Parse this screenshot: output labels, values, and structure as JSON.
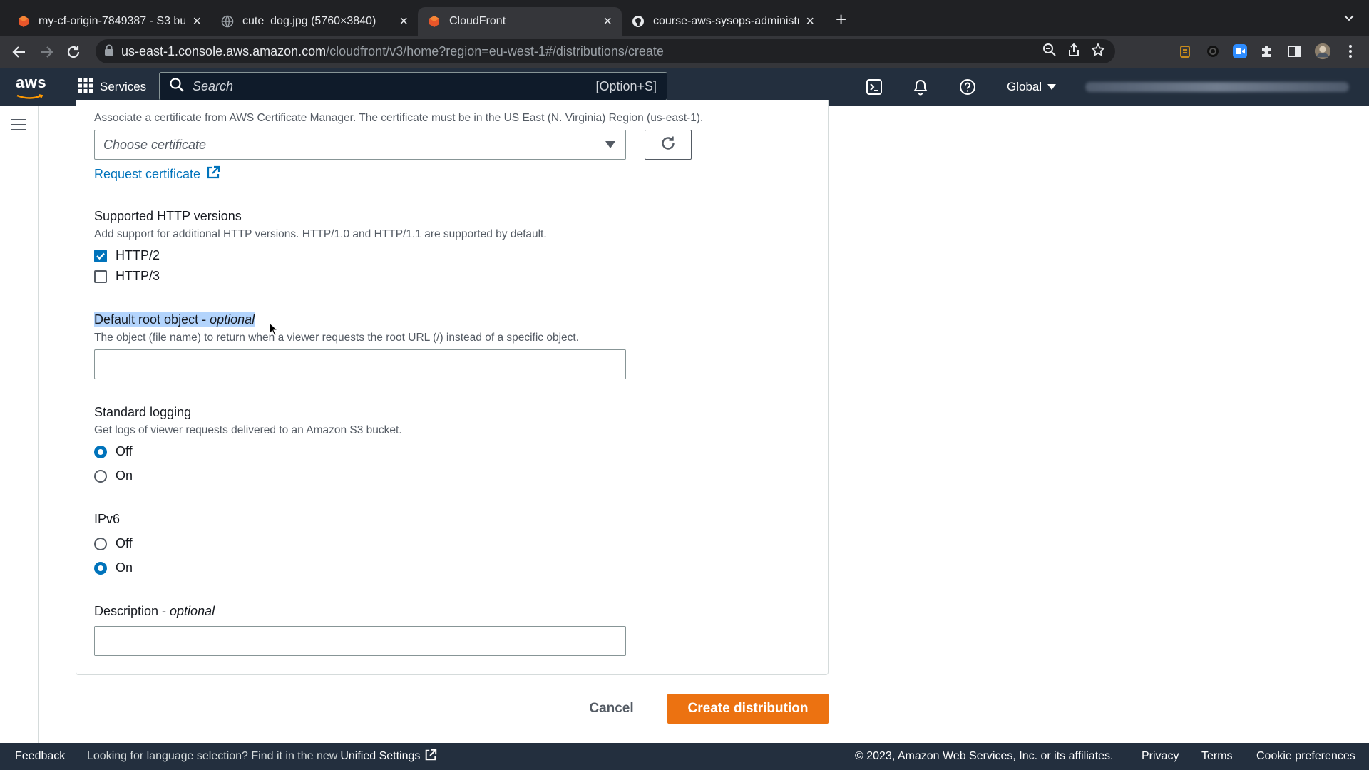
{
  "browser": {
    "tabs": [
      {
        "title": "my-cf-origin-7849387 - S3 bu"
      },
      {
        "title": "cute_dog.jpg (5760×3840)"
      },
      {
        "title": "CloudFront"
      },
      {
        "title": "course-aws-sysops-administra"
      }
    ],
    "url_host": "us-east-1.console.aws.amazon.com",
    "url_path": "/cloudfront/v3/home?region=eu-west-1#/distributions/create"
  },
  "awsnav": {
    "logo_text": "aws",
    "services_label": "Services",
    "search_placeholder": "Search",
    "search_shortcut": "[Option+S]",
    "region_label": "Global"
  },
  "form": {
    "certificate": {
      "description": "Associate a certificate from AWS Certificate Manager. The certificate must be in the US East (N. Virginia) Region (us-east-1).",
      "placeholder": "Choose certificate",
      "request_link": "Request certificate"
    },
    "http_versions": {
      "label": "Supported HTTP versions",
      "description": "Add support for additional HTTP versions. HTTP/1.0 and HTTP/1.1 are supported by default.",
      "options": [
        {
          "label": "HTTP/2",
          "checked": true
        },
        {
          "label": "HTTP/3",
          "checked": false
        }
      ]
    },
    "default_root": {
      "label": "Default root object - ",
      "optional": "optional",
      "description": "The object (file name) to return when a viewer requests the root URL (/) instead of a specific object.",
      "value": ""
    },
    "logging": {
      "label": "Standard logging",
      "description": "Get logs of viewer requests delivered to an Amazon S3 bucket.",
      "options": [
        {
          "label": "Off",
          "selected": true
        },
        {
          "label": "On",
          "selected": false
        }
      ]
    },
    "ipv6": {
      "label": "IPv6",
      "options": [
        {
          "label": "Off",
          "selected": false
        },
        {
          "label": "On",
          "selected": true
        }
      ]
    },
    "description_field": {
      "label": "Description - ",
      "optional": "optional",
      "value": ""
    }
  },
  "actions": {
    "cancel": "Cancel",
    "create": "Create distribution"
  },
  "footer": {
    "feedback": "Feedback",
    "language_text": "Looking for language selection? Find it in the new ",
    "unified_settings": "Unified Settings",
    "copyright": "© 2023, Amazon Web Services, Inc. or its affiliates.",
    "privacy": "Privacy",
    "terms": "Terms",
    "cookies": "Cookie preferences"
  },
  "colors": {
    "aws_nav": "#232f3e",
    "primary_button": "#ec7211",
    "link": "#0073bb",
    "selection": "#b3d4fc"
  }
}
